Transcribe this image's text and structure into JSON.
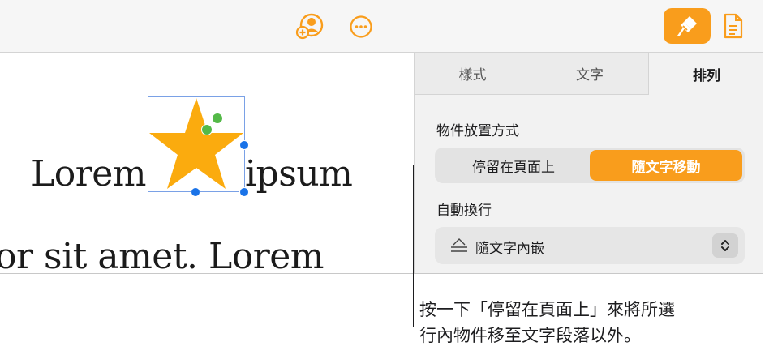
{
  "toolbar": {
    "collaborate_icon": "add-collaborator-icon",
    "more_icon": "more-options-icon",
    "format_icon": "format-paintbrush-icon",
    "document_icon": "document-icon",
    "accent": "#f99d1c"
  },
  "canvas": {
    "word_left": "Lorem",
    "word_right": "ipsum",
    "line_two": "or sit amet. Lorem",
    "shape": "star",
    "shape_color": "#fbab0e"
  },
  "panel": {
    "tabs": [
      {
        "label": "樣式",
        "selected": false
      },
      {
        "label": "文字",
        "selected": false
      },
      {
        "label": "排列",
        "selected": true
      }
    ],
    "placement": {
      "label": "物件放置方式",
      "options": [
        "停留在頁面上",
        "隨文字移動"
      ],
      "selected": "隨文字移動"
    },
    "wrap": {
      "label": "自動換行",
      "value": "隨文字內嵌",
      "icon": "inline-wrap-icon"
    }
  },
  "callout": {
    "line1": "按一下「停留在頁面上」來將所選",
    "line2": "行內物件移至文字段落以外。"
  }
}
